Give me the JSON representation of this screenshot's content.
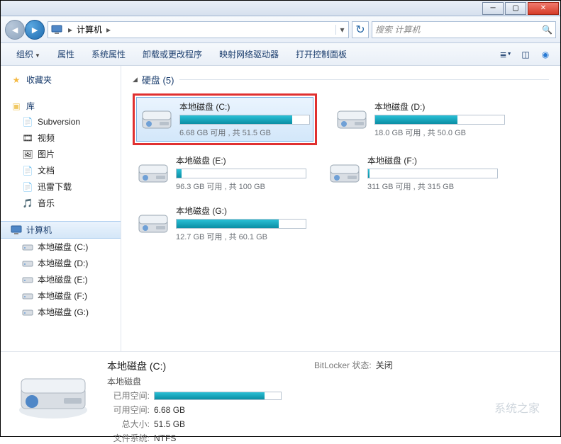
{
  "titlebar": {
    "min": "─",
    "max": "▢",
    "close": "✕"
  },
  "nav": {
    "back": "◄",
    "fwd": "►",
    "crumb_root": "计算机",
    "crumb_sep": "▸",
    "refresh": "↻",
    "search_placeholder": "搜索  计算机",
    "search_icon": "🔍"
  },
  "toolbar": {
    "organize": "组织",
    "properties": "属性",
    "sys_properties": "系统属性",
    "uninstall": "卸载或更改程序",
    "map_drive": "映射网络驱动器",
    "control_panel": "打开控制面板"
  },
  "sidebar": {
    "favorites": "收藏夹",
    "libraries": "库",
    "lib_items": [
      {
        "icon": "📄",
        "label": "Subversion"
      },
      {
        "icon": "🎞",
        "label": "视频"
      },
      {
        "icon": "🖼",
        "label": "图片"
      },
      {
        "icon": "📄",
        "label": "文档"
      },
      {
        "icon": "📄",
        "label": "迅雷下载"
      },
      {
        "icon": "🎵",
        "label": "音乐"
      }
    ],
    "computer": "计算机",
    "drives": [
      {
        "label": "本地磁盘 (C:)"
      },
      {
        "label": "本地磁盘 (D:)"
      },
      {
        "label": "本地磁盘 (E:)"
      },
      {
        "label": "本地磁盘 (F:)"
      },
      {
        "label": "本地磁盘 (G:)"
      }
    ]
  },
  "content": {
    "group_label": "硬盘 (5)",
    "drives": [
      {
        "name": "本地磁盘 (C:)",
        "stat": "6.68 GB 可用 , 共 51.5 GB",
        "fill": 87,
        "selected": true,
        "framed": true
      },
      {
        "name": "本地磁盘 (D:)",
        "stat": "18.0 GB 可用 , 共 50.0 GB",
        "fill": 64
      },
      {
        "name": "本地磁盘 (E:)",
        "stat": "96.3 GB 可用 , 共 100 GB",
        "fill": 4
      },
      {
        "name": "本地磁盘 (F:)",
        "stat": "311 GB 可用 , 共 315 GB",
        "fill": 1
      },
      {
        "name": "本地磁盘 (G:)",
        "stat": "12.7 GB 可用 , 共 60.1 GB",
        "fill": 79
      }
    ]
  },
  "details": {
    "title": "本地磁盘 (C:)",
    "subtitle": "本地磁盘",
    "used_label": "已用空间:",
    "used_fill": 87,
    "free_label": "可用空间:",
    "free_val": "6.68 GB",
    "total_label": "总大小:",
    "total_val": "51.5 GB",
    "fs_label": "文件系统:",
    "fs_val": "NTFS",
    "bitlocker_label": "BitLocker 状态:",
    "bitlocker_val": "关闭"
  },
  "watermark": "系统之家"
}
